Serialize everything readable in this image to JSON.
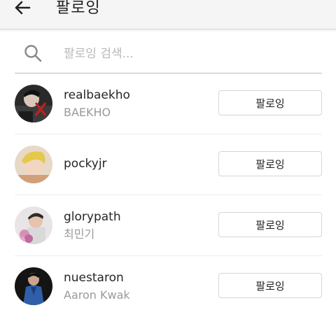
{
  "header": {
    "title": "팔로잉"
  },
  "search": {
    "placeholder": "팔로잉 검색..."
  },
  "follow_label": "팔로잉",
  "users": [
    {
      "username": "realbaekho",
      "full_name": "BAEKHO"
    },
    {
      "username": "pockyjr",
      "full_name": ""
    },
    {
      "username": "glorypath",
      "full_name": "최민기"
    },
    {
      "username": "nuestaron",
      "full_name": "Aaron Kwak"
    }
  ]
}
